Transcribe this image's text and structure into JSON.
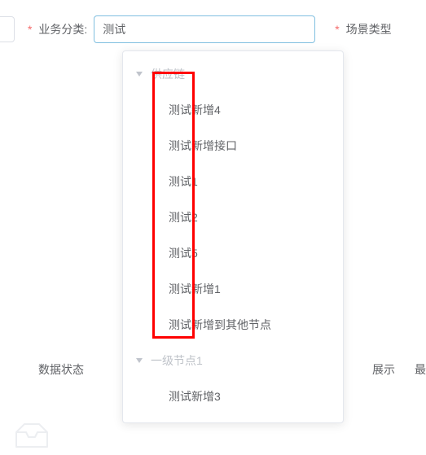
{
  "form": {
    "business_category_label": "业务分类:",
    "business_category_value": "测试",
    "scene_type_label": "场景类型"
  },
  "dropdown": {
    "groups": [
      {
        "name": "供应链",
        "items": [
          "测试新增4",
          "测试新增接口",
          "测试1",
          "测试2",
          "测试5",
          "测试新增1",
          "测试新增到其他节点"
        ]
      },
      {
        "name": "一级节点1",
        "items": [
          "测试新增3"
        ]
      }
    ]
  },
  "table": {
    "col_data_status": "数据状态",
    "col_display_fragment": "展示",
    "col_last_fragment": "最"
  },
  "colors": {
    "required_star": "#f56c6c",
    "input_focus_border": "#80bfe0",
    "highlight_border": "#ff0000",
    "group_label": "#bfc3c9"
  }
}
